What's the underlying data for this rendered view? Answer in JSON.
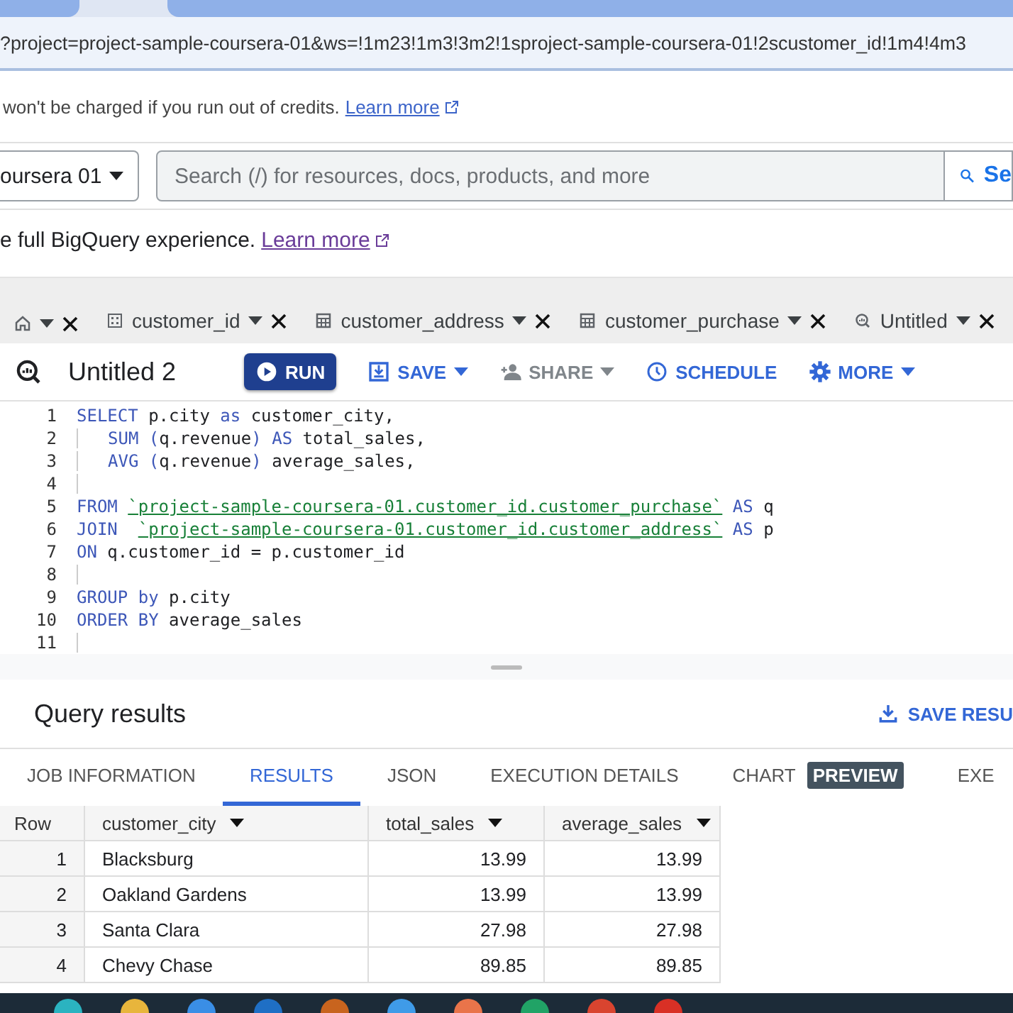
{
  "browser": {
    "url": "?project=project-sample-coursera-01&ws=!1m23!1m3!3m2!1sproject-sample-coursera-01!2scustomer_id!1m4!4m3"
  },
  "notice": {
    "text": "won't be charged if you run out of credits.",
    "link": "Learn more"
  },
  "project_picker": {
    "label": "oursera 01"
  },
  "search": {
    "placeholder": "Search (/) for resources, docs, products, and more",
    "button": "Se"
  },
  "promo": {
    "text": "e full BigQuery experience.",
    "link": "Learn more"
  },
  "editor_tabs": [
    {
      "kind": "home"
    },
    {
      "kind": "dataset",
      "label": "customer_id"
    },
    {
      "kind": "table",
      "label": "customer_address"
    },
    {
      "kind": "table",
      "label": "customer_purchase"
    },
    {
      "kind": "query",
      "label": "Untitled"
    }
  ],
  "toolbar": {
    "title": "Untitled 2",
    "buttons": [
      {
        "kind": "run",
        "label": "RUN",
        "disabled": false,
        "caret": false
      },
      {
        "kind": "save",
        "label": "SAVE",
        "disabled": false,
        "caret": true
      },
      {
        "kind": "share",
        "label": "SHARE",
        "disabled": true,
        "caret": true
      },
      {
        "kind": "schedule",
        "label": "SCHEDULE",
        "disabled": false,
        "caret": false
      },
      {
        "kind": "more",
        "label": "MORE",
        "disabled": false,
        "caret": true
      }
    ]
  },
  "editor": {
    "lines": [
      {
        "number": "1",
        "indent": false,
        "tokens": [
          {
            "kind": "keyword",
            "text": "SELECT"
          },
          {
            "kind": "plain",
            "text": " p.city "
          },
          {
            "kind": "keyword",
            "text": "as"
          },
          {
            "kind": "plain",
            "text": " customer_city,"
          }
        ]
      },
      {
        "number": "2",
        "indent": true,
        "tokens": [
          {
            "kind": "keyword",
            "text": "SUM ("
          },
          {
            "kind": "plain",
            "text": "q.revenue"
          },
          {
            "kind": "keyword",
            "text": ") AS"
          },
          {
            "kind": "plain",
            "text": " total_sales,"
          }
        ]
      },
      {
        "number": "3",
        "indent": true,
        "tokens": [
          {
            "kind": "keyword",
            "text": "AVG ("
          },
          {
            "kind": "plain",
            "text": "q.revenue"
          },
          {
            "kind": "keyword",
            "text": ")"
          },
          {
            "kind": "plain",
            "text": " average_sales,"
          }
        ]
      },
      {
        "number": "4",
        "indent": true
      },
      {
        "number": "5",
        "indent": false,
        "tokens": [
          {
            "kind": "keyword",
            "text": "FROM "
          },
          {
            "kind": "string",
            "text": "`project-sample-coursera-01.customer_id.customer_purchase`"
          },
          {
            "kind": "keyword",
            "text": " AS"
          },
          {
            "kind": "plain",
            "text": " q"
          }
        ]
      },
      {
        "number": "6",
        "indent": false,
        "tokens": [
          {
            "kind": "keyword",
            "text": "JOIN  "
          },
          {
            "kind": "string",
            "text": "`project-sample-coursera-01.customer_id.customer_address`"
          },
          {
            "kind": "keyword",
            "text": " AS"
          },
          {
            "kind": "plain",
            "text": " p"
          }
        ]
      },
      {
        "number": "7",
        "indent": false,
        "tokens": [
          {
            "kind": "keyword",
            "text": "ON"
          },
          {
            "kind": "plain",
            "text": " q.customer_id = p.customer_id"
          }
        ]
      },
      {
        "number": "8",
        "indent": false
      },
      {
        "number": "9",
        "indent": false,
        "tokens": [
          {
            "kind": "keyword",
            "text": "GROUP by"
          },
          {
            "kind": "plain",
            "text": " p.city"
          }
        ]
      },
      {
        "number": "10",
        "indent": false,
        "tokens": [
          {
            "kind": "keyword",
            "text": "ORDER BY"
          },
          {
            "kind": "plain",
            "text": " average_sales"
          }
        ]
      },
      {
        "number": "11",
        "indent": false
      }
    ]
  },
  "results": {
    "title": "Query results",
    "save_label": "SAVE RESU",
    "tabs": [
      {
        "label": "JOB INFORMATION",
        "selected": false
      },
      {
        "label": "RESULTS",
        "selected": true
      },
      {
        "label": "JSON",
        "selected": false
      },
      {
        "label": "EXECUTION DETAILS",
        "selected": false
      },
      {
        "label": "CHART",
        "selected": false,
        "badge": "PREVIEW"
      },
      {
        "label": "EXE",
        "selected": false
      }
    ],
    "columns": [
      "Row",
      "customer_city",
      "total_sales",
      "average_sales"
    ],
    "rows": [
      [
        "1",
        "Blacksburg",
        "13.99",
        "13.99"
      ],
      [
        "2",
        "Oakland Gardens",
        "13.99",
        "13.99"
      ],
      [
        "3",
        "Santa Clara",
        "27.98",
        "27.98"
      ],
      [
        "4",
        "Chevy Chase",
        "89.85",
        "89.85"
      ]
    ]
  },
  "taskbar": {
    "apps": [
      {
        "color": "#2bb3c0"
      },
      {
        "color": "#e8b53c"
      },
      {
        "color": "#3a8ee6"
      },
      {
        "color": "#1f6fc5"
      },
      {
        "color": "#c8641e"
      },
      {
        "color": "#3f9be8"
      },
      {
        "color": "#e9744a"
      },
      {
        "color": "#21a366"
      },
      {
        "color": "#d9442f"
      },
      {
        "color": "#d93025"
      }
    ]
  }
}
